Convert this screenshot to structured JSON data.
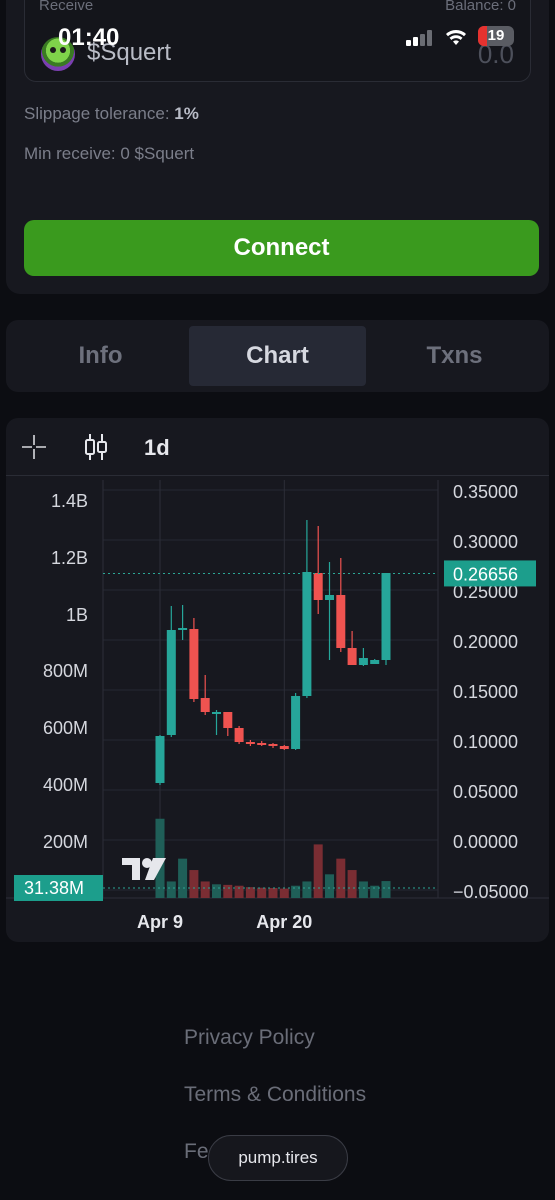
{
  "status_bar": {
    "time": "01:40",
    "battery": "19"
  },
  "swap": {
    "receive_label": "Receive",
    "balance_label": "Balance: 0",
    "token_name": "$Squert",
    "amount": "0.0",
    "slippage_label": "Slippage tolerance:",
    "slippage_value": "1%",
    "min_receive": "Min receive: 0 $Squert",
    "connect_label": "Connect"
  },
  "tabs": [
    {
      "label": "Info",
      "active": false
    },
    {
      "label": "Chart",
      "active": true
    },
    {
      "label": "Txns",
      "active": false
    }
  ],
  "chart_toolbar": {
    "interval": "1d"
  },
  "chart_data": {
    "type": "candlestick",
    "x_dates": [
      "Apr 9",
      "Apr 20"
    ],
    "x_tick_labels": [
      "Apr 9",
      "Apr 20"
    ],
    "price_axis_labels": [
      "0.35000",
      "0.30000",
      "0.25000",
      "0.20000",
      "0.15000",
      "0.10000",
      "0.05000",
      "0.00000",
      "−0.05000"
    ],
    "volume_axis_labels": [
      "1.4B",
      "1.2B",
      "1B",
      "800M",
      "600M",
      "400M",
      "200M"
    ],
    "price_ylim": [
      -0.05,
      0.35
    ],
    "volume_ylim": [
      0,
      1400000000
    ],
    "last_price": 0.26656,
    "last_price_label": "0.26656",
    "last_volume_label": "31.38M",
    "up_color": "#26a69a",
    "down_color": "#ef5350",
    "candles": [
      {
        "o": 0.057,
        "h": 0.105,
        "l": 0.055,
        "c": 0.104
      },
      {
        "o": 0.105,
        "h": 0.234,
        "l": 0.103,
        "c": 0.21
      },
      {
        "o": 0.21,
        "h": 0.235,
        "l": 0.2,
        "c": 0.212
      },
      {
        "o": 0.211,
        "h": 0.222,
        "l": 0.138,
        "c": 0.141
      },
      {
        "o": 0.142,
        "h": 0.165,
        "l": 0.125,
        "c": 0.128
      },
      {
        "o": 0.128,
        "h": 0.13,
        "l": 0.105,
        "c": 0.128
      },
      {
        "o": 0.128,
        "h": 0.128,
        "l": 0.104,
        "c": 0.112
      },
      {
        "o": 0.112,
        "h": 0.114,
        "l": 0.096,
        "c": 0.098
      },
      {
        "o": 0.098,
        "h": 0.1,
        "l": 0.094,
        "c": 0.097
      },
      {
        "o": 0.097,
        "h": 0.099,
        "l": 0.094,
        "c": 0.096
      },
      {
        "o": 0.096,
        "h": 0.097,
        "l": 0.092,
        "c": 0.094
      },
      {
        "o": 0.094,
        "h": 0.095,
        "l": 0.09,
        "c": 0.091
      },
      {
        "o": 0.091,
        "h": 0.147,
        "l": 0.09,
        "c": 0.144
      },
      {
        "o": 0.144,
        "h": 0.32,
        "l": 0.142,
        "c": 0.268
      },
      {
        "o": 0.267,
        "h": 0.314,
        "l": 0.226,
        "c": 0.24
      },
      {
        "o": 0.24,
        "h": 0.278,
        "l": 0.18,
        "c": 0.245
      },
      {
        "o": 0.245,
        "h": 0.282,
        "l": 0.188,
        "c": 0.192
      },
      {
        "o": 0.192,
        "h": 0.209,
        "l": 0.18,
        "c": 0.175
      },
      {
        "o": 0.175,
        "h": 0.192,
        "l": 0.174,
        "c": 0.182
      },
      {
        "o": 0.176,
        "h": 0.181,
        "l": 0.176,
        "c": 0.18
      },
      {
        "o": 0.18,
        "h": 0.267,
        "l": 0.175,
        "c": 0.267
      }
    ],
    "volumes": [
      250000000,
      30000000,
      110000000,
      70000000,
      30000000,
      20000000,
      18000000,
      15000000,
      10000000,
      8000000,
      7000000,
      5000000,
      15000000,
      30000000,
      160000000,
      55000000,
      110000000,
      70000000,
      30000000,
      15000000,
      31380000
    ]
  },
  "footer": {
    "privacy": "Privacy Policy",
    "terms": "Terms & Conditions",
    "fees": "Fees",
    "domain_pill": "pump.tires"
  }
}
